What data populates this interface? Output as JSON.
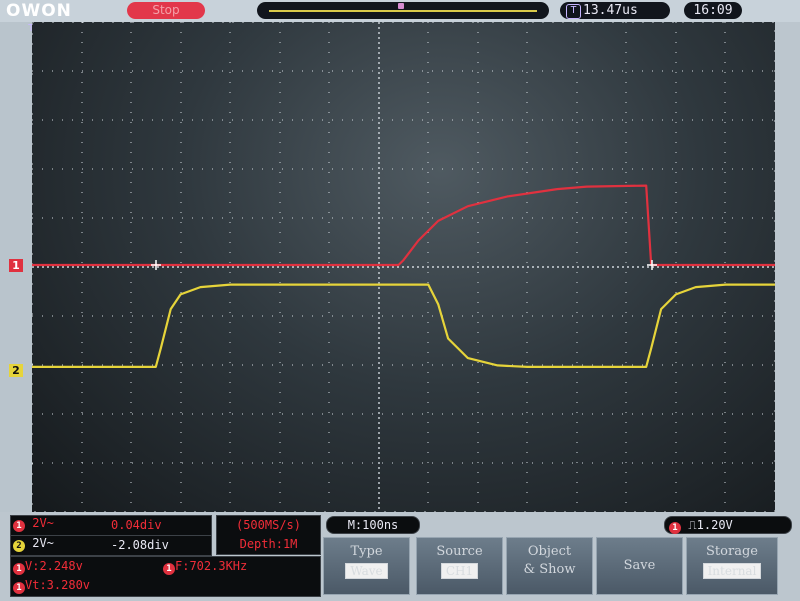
{
  "brand": {
    "logo": "OWON"
  },
  "status": {
    "run_state": "Stop",
    "trigger_position": "13.47us",
    "clock": "16:09"
  },
  "channels": {
    "ch1": {
      "marker": "1",
      "color": "#e0313f"
    },
    "ch2": {
      "marker": "2",
      "color": "#e6d43a"
    }
  },
  "readouts": {
    "ch1_scale": "2V~",
    "ch1_offset": "0.04div",
    "ch2_scale": "2V~",
    "ch2_offset": "-2.08div",
    "sample_rate": "(500MS/s)",
    "depth": "Depth:1M",
    "voltage": "V:2.248v",
    "frequency": "F:702.3KHz",
    "vt": "Vt:3.280v",
    "timebase": "M:100ns",
    "trigger_level": "1.20V"
  },
  "menu": [
    {
      "label": "Type",
      "value": "Wave"
    },
    {
      "label": "Source",
      "value": "CH1"
    },
    {
      "label": "Object",
      "value": "& Show"
    },
    {
      "label": "Save",
      "value": ""
    },
    {
      "label": "Storage",
      "value": "Internal"
    }
  ],
  "chart_data": {
    "type": "line",
    "title": "",
    "xlabel": "",
    "ylabel": "",
    "x_divisions": 15,
    "y_divisions": 10,
    "grid": true,
    "series": [
      {
        "color": "#e0313f",
        "x": [
          0,
          7.4,
          7.5,
          7.8,
          8.2,
          8.8,
          9.6,
          10.6,
          11.2,
          12.4,
          12.5,
          15
        ],
        "y": [
          0,
          0,
          0.1,
          0.5,
          0.9,
          1.2,
          1.4,
          1.55,
          1.6,
          1.62,
          0,
          0
        ]
      },
      {
        "color": "#e6d43a",
        "x": [
          0,
          2.5,
          2.6,
          2.8,
          3.0,
          3.4,
          4.0,
          8.0,
          8.2,
          8.4,
          8.8,
          9.4,
          10,
          12.4,
          12.5,
          12.7,
          13.0,
          13.4,
          14,
          15
        ],
        "y": [
          -2.08,
          -2.08,
          -1.7,
          -0.9,
          -0.6,
          -0.45,
          -0.4,
          -0.4,
          -0.8,
          -1.5,
          -1.9,
          -2.05,
          -2.08,
          -2.08,
          -1.7,
          -0.9,
          -0.6,
          -0.45,
          -0.4,
          -0.4
        ]
      }
    ]
  }
}
